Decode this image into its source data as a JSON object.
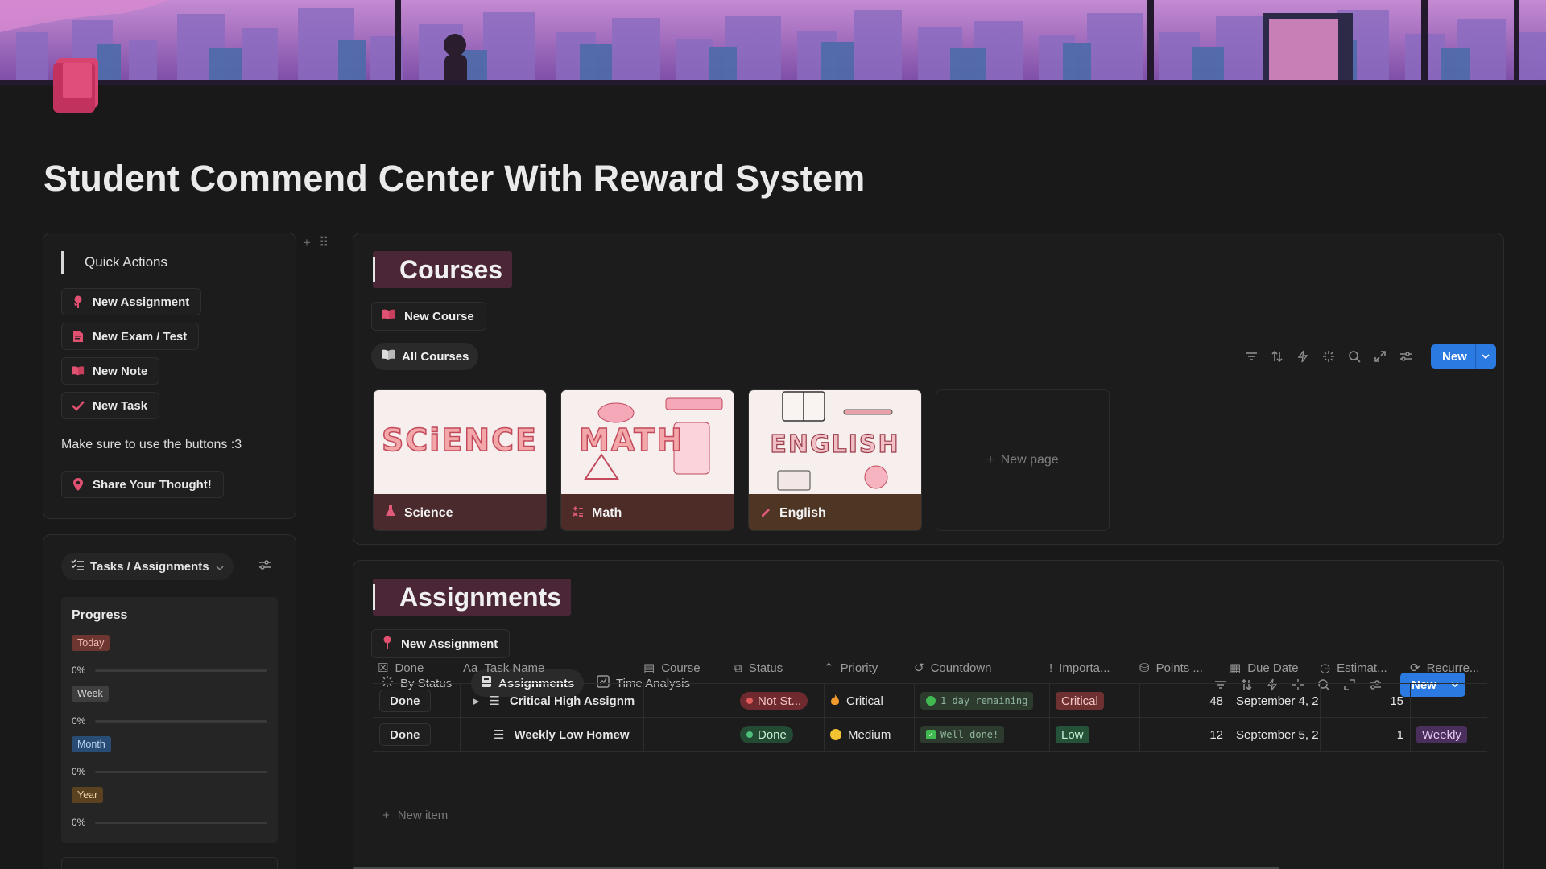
{
  "page": {
    "title": "Student Commend Center With Reward System"
  },
  "quick_actions": {
    "heading": "Quick Actions",
    "buttons": [
      {
        "label": "New Assignment",
        "icon": "rose-icon"
      },
      {
        "label": "New Exam / Test",
        "icon": "document-icon"
      },
      {
        "label": "New Note",
        "icon": "book-open-icon"
      },
      {
        "label": "New Task",
        "icon": "checkmark-icon"
      }
    ],
    "note": "Make sure to use the buttons :3",
    "share_label": "Share Your Thought!"
  },
  "tasks": {
    "tab_label": "Tasks / Assignments",
    "progress_title": "Progress",
    "periods": [
      {
        "label": "Today",
        "value": "0%",
        "color": "#6e3630",
        "text_color": "#f0b7b0"
      },
      {
        "label": "Week",
        "value": "0%",
        "color": "#3e3e3e",
        "text_color": "#d6d6d6"
      },
      {
        "label": "Month",
        "value": "0%",
        "color": "#284c74",
        "text_color": "#bcd6f3"
      },
      {
        "label": "Year",
        "value": "0%",
        "color": "#5a4220",
        "text_color": "#ecd0a6"
      }
    ]
  },
  "courses": {
    "title": "Courses",
    "new_button": "New Course",
    "view_tab": "All Courses",
    "new_label": "New",
    "cards": [
      {
        "name": "Science",
        "cover_word": "SCiENCE",
        "icon": "flask-icon",
        "footer_color": "#4a2a2c"
      },
      {
        "name": "Math",
        "cover_word": "MATH",
        "icon": "calculator-icon",
        "footer_color": "#4d2c28"
      },
      {
        "name": "English",
        "cover_word": "ENGLISH",
        "icon": "pencil-icon",
        "footer_color": "#4f3624"
      }
    ],
    "new_page_label": "New page"
  },
  "assignments": {
    "title": "Assignments",
    "new_button": "New Assignment",
    "tabs": [
      "By Status",
      "Assignments",
      "Time Analysis"
    ],
    "active_tab": "Assignments",
    "new_label": "New",
    "columns": [
      "Done",
      "Task Name",
      "Course",
      "Status",
      "Priority",
      "Countdown",
      "Importa...",
      "Points ...",
      "Due Date",
      "Estimat...",
      "Recurre..."
    ],
    "rows": [
      {
        "done": "Done",
        "task": "Critical High Assignm",
        "course": "",
        "status": "Not St...",
        "status_color": "#6e2a2e",
        "status_dot": "#e05a5a",
        "priority": "Critical",
        "priority_icon": "flame-icon",
        "countdown": "1 day remaining",
        "countdown_icon": "green-circle-icon",
        "importance": "Critical",
        "importance_color": "#6e3030",
        "points": "48",
        "due": "September 4, 2",
        "estimate": "15",
        "recurrence": ""
      },
      {
        "done": "Done",
        "task": "Weekly Low Homew",
        "course": "",
        "status": "Done",
        "status_color": "#234b34",
        "status_dot": "#4ec07a",
        "priority": "Medium",
        "priority_icon": "yellow-circle-icon",
        "countdown": "Well done!",
        "countdown_icon": "check-box-icon",
        "importance": "Low",
        "importance_color": "#24533a",
        "points": "12",
        "due": "September 5, 2",
        "estimate": "1",
        "recurrence": "Weekly"
      }
    ],
    "new_item_label": "New item"
  }
}
